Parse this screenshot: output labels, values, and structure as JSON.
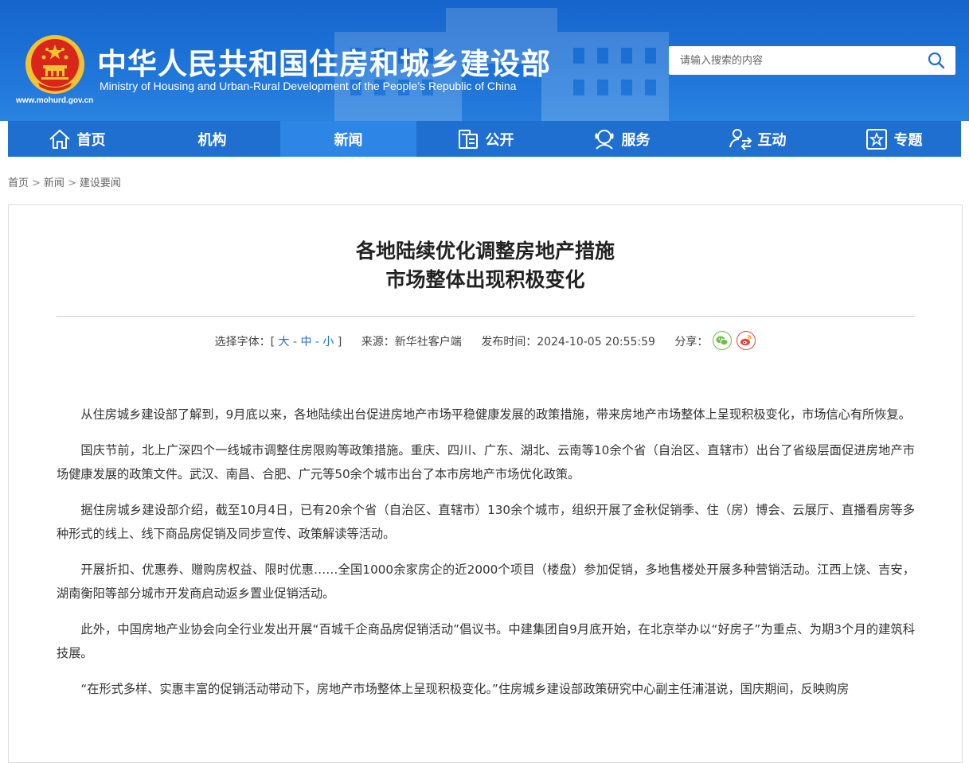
{
  "header": {
    "site_url": "www.mohurd.gov.cn",
    "title_cn": "中华人民共和国住房和城乡建设部",
    "title_en": "Ministry of Housing and Urban-Rural Development of the People’s Republic of China",
    "search_placeholder": "请输入搜索的内容"
  },
  "nav": [
    {
      "label": "首页",
      "icon": "home-icon"
    },
    {
      "label": "机构",
      "icon": ""
    },
    {
      "label": "新闻",
      "icon": "",
      "active": true
    },
    {
      "label": "公开",
      "icon": "disclosure-icon"
    },
    {
      "label": "服务",
      "icon": "service-icon"
    },
    {
      "label": "互动",
      "icon": "interact-icon"
    },
    {
      "label": "专题",
      "icon": "topic-icon"
    }
  ],
  "breadcrumb": [
    "首页",
    "新闻",
    "建设要闻"
  ],
  "article": {
    "title_line1": "各地陆续优化调整房地产措施",
    "title_line2": "市场整体出现积极变化",
    "font_label": "选择字体：[",
    "font_large": "大",
    "font_medium": "中",
    "font_small": "小",
    "font_end": "]",
    "source": "来源：新华社客户端",
    "publish_time": "发布时间：2024-10-05 20:55:59",
    "share_label": "分享：",
    "paragraphs": [
      "从住房城乡建设部了解到，9月底以来，各地陆续出台促进房地产市场平稳健康发展的政策措施，带来房地产市场整体上呈现积极变化，市场信心有所恢复。",
      "国庆节前，北上广深四个一线城市调整住房限购等政策措施。重庆、四川、广东、湖北、云南等10余个省（自治区、直辖市）出台了省级层面促进房地产市场健康发展的政策文件。武汉、南昌、合肥、广元等50余个城市出台了本市房地产市场优化政策。",
      "据住房城乡建设部介绍，截至10月4日，已有20余个省（自治区、直辖市）130余个城市，组织开展了金秋促销季、住（房）博会、云展厅、直播看房等多种形式的线上、线下商品房促销及同步宣传、政策解读等活动。",
      "开展折扣、优惠券、赠购房权益、限时优惠……全国1000余家房企的近2000个项目（楼盘）参加促销，多地售楼处开展多种营销活动。江西上饶、吉安，湖南衡阳等部分城市开发商启动返乡置业促销活动。",
      "此外，中国房地产业协会向全行业发出开展“百城千企商品房促销活动”倡议书。中建集团自9月底开始，在北京举办以“好房子”为重点、为期3个月的建筑科技展。",
      "“在形式多样、实惠丰富的促销活动带动下，房地产市场整体上呈现积极变化。”住房城乡建设部政策研究中心副主任浦湛说，国庆期间，反映购房"
    ]
  },
  "colors": {
    "header_blue": "#1565cc",
    "nav_blue": "#1f6fd1",
    "nav_active": "#2d86e6",
    "emblem_red": "#d8261c",
    "emblem_gold": "#f3c231"
  }
}
